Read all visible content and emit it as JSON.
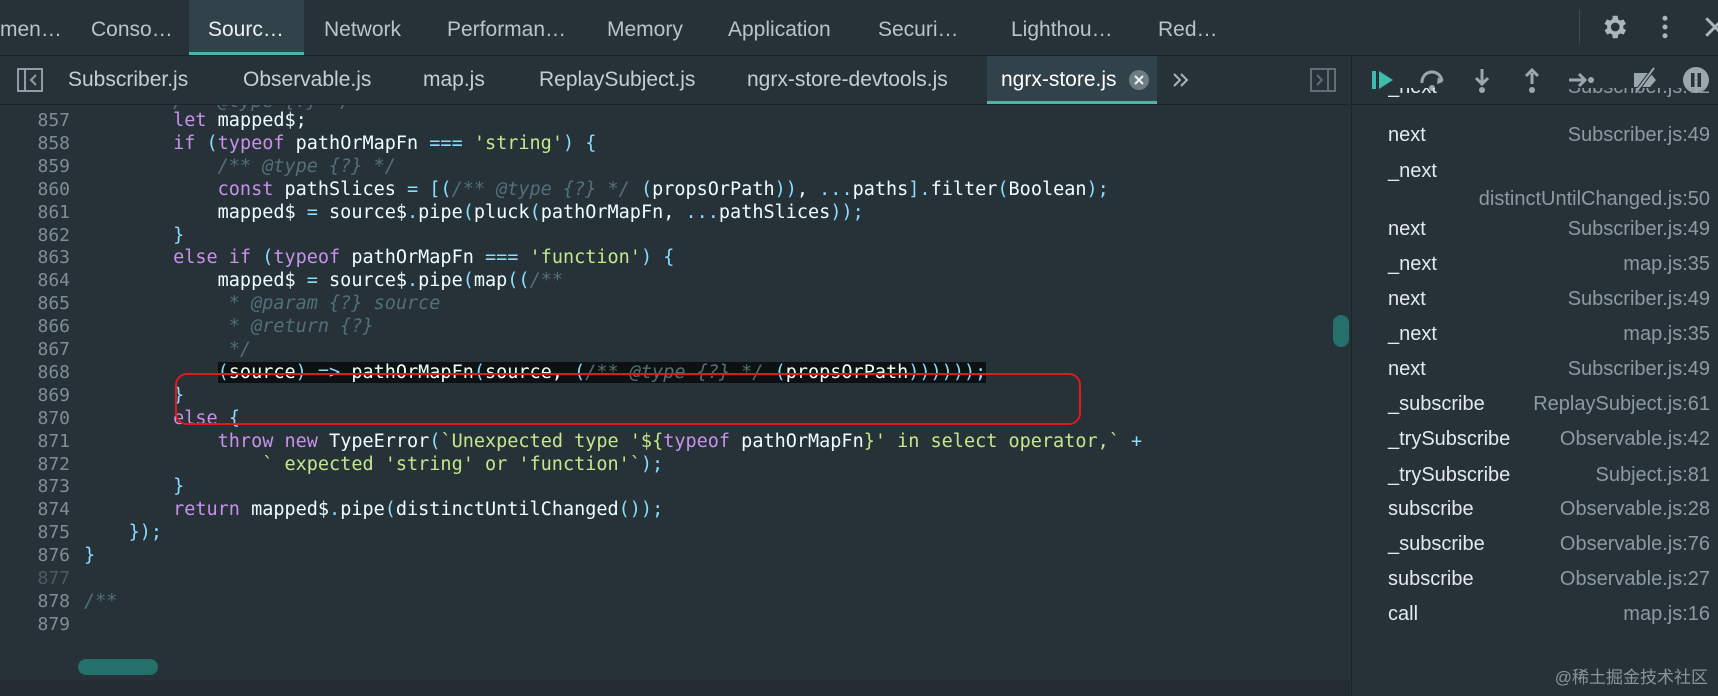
{
  "panel_tabs": [
    {
      "label": "men…"
    },
    {
      "label": "Conso…"
    },
    {
      "label": "Sourc…"
    },
    {
      "label": "Network"
    },
    {
      "label": "Performan…"
    },
    {
      "label": "Memory"
    },
    {
      "label": "Application"
    },
    {
      "label": "Securi…"
    },
    {
      "label": "Lighthou…"
    },
    {
      "label": "Red…"
    }
  ],
  "file_tabs": [
    {
      "label": "Subscriber.js"
    },
    {
      "label": "Observable.js"
    },
    {
      "label": "map.js"
    },
    {
      "label": "ReplaySubject.js"
    },
    {
      "label": "ngrx-store-devtools.js"
    },
    {
      "label": "ngrx-store.js"
    }
  ],
  "line_numbers": [
    "857",
    "858",
    "859",
    "860",
    "861",
    "862",
    "863",
    "864",
    "865",
    "866",
    "867",
    "868",
    "869",
    "870",
    "871",
    "872",
    "873",
    "874",
    "875",
    "876",
    "877",
    "878",
    "879"
  ],
  "call_stack": [
    {
      "name": "_next",
      "loc": "Subscriber.js:72"
    },
    {
      "name": "next",
      "loc": "Subscriber.js:49"
    },
    {
      "name": "_next",
      "loc": "distinctUntilChanged.js:50"
    },
    {
      "name": "next",
      "loc": "Subscriber.js:49"
    },
    {
      "name": "_next",
      "loc": "map.js:35"
    },
    {
      "name": "next",
      "loc": "Subscriber.js:49"
    },
    {
      "name": "_next",
      "loc": "map.js:35"
    },
    {
      "name": "next",
      "loc": "Subscriber.js:49"
    },
    {
      "name": "_subscribe",
      "loc": "ReplaySubject.js:61"
    },
    {
      "name": "_trySubscribe",
      "loc": "Observable.js:42"
    },
    {
      "name": "_trySubscribe",
      "loc": "Subject.js:81"
    },
    {
      "name": "subscribe",
      "loc": "Observable.js:28"
    },
    {
      "name": "_subscribe",
      "loc": "Observable.js:76"
    },
    {
      "name": "subscribe",
      "loc": "Observable.js:27"
    },
    {
      "name": "call",
      "loc": "map.js:16"
    }
  ],
  "watermark": "@稀土掘金技术社区",
  "colors": {
    "accent": "#4fb3a9",
    "highlight_box": "#e0191f",
    "background": "#263238"
  },
  "icons": [
    "settings-icon",
    "more-vert-icon",
    "close-devtools-icon",
    "toggle-navigator-icon",
    "toggle-debugger-icon",
    "close-tab-icon",
    "more-tabs-icon",
    "resume-icon",
    "step-over-icon",
    "step-into-icon",
    "step-out-icon",
    "step-icon",
    "deactivate-breakpoints-icon",
    "pause-exceptions-icon"
  ]
}
